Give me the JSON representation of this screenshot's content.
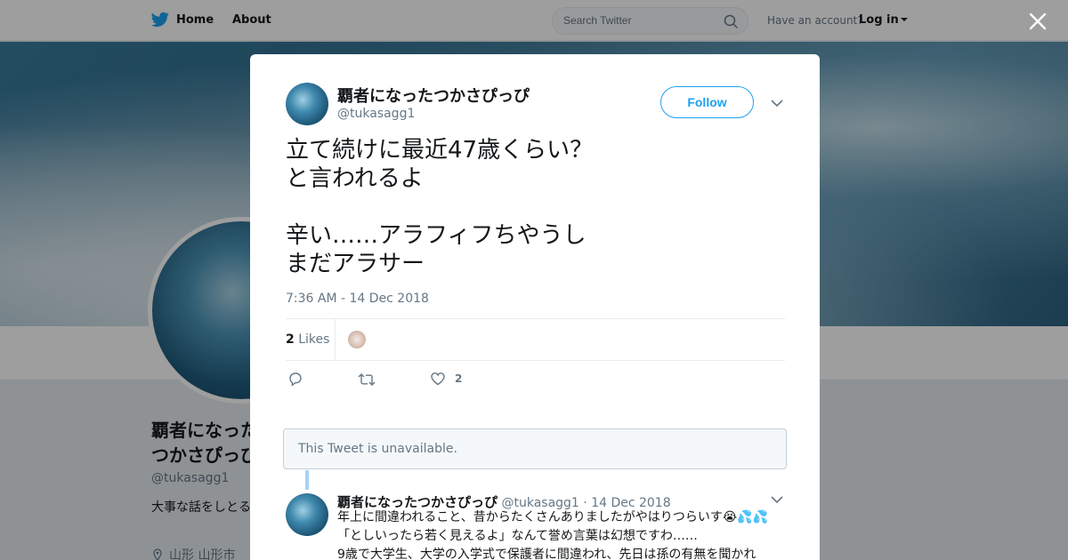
{
  "topbar": {
    "home_label": "Home",
    "about_label": "About",
    "search_placeholder": "Search Twitter",
    "account_prompt": "Have an account?",
    "login_label": "Log in"
  },
  "profile": {
    "name": "覇者になったつかさぴっぴ",
    "handle": "@tukasagg1",
    "bio": "大事な話をしとるマンミサンドリス",
    "location": "山形 山形市"
  },
  "tweet": {
    "author_name": "覇者になったつかさぴっぴ",
    "author_handle": "@tukasagg1",
    "follow_label": "Follow",
    "text_lines": [
      "立て続けに最近47歳くらい？",
      "と言われるよ",
      "",
      "辛い……アラフィフちやうし",
      "まだアラサー"
    ],
    "timestamp": "7:36 AM - 14 Dec 2018",
    "likes_count": "2",
    "likes_label": "Likes",
    "like_action_count": "2"
  },
  "unavailable_notice": "This Tweet is unavailable.",
  "reply": {
    "author_name": "覇者になったつかさぴっぴ",
    "author_handle": "@tukasagg1",
    "separator": "·",
    "date": "14 Dec 2018",
    "lines": [
      "年上に間違われること、昔からたくさんありましたがやはりつらいす😭💦💦",
      "「としいったら若く見えるよ」なんて誉め言葉は幻想ですわ……",
      "9歳で大学生、大学の入学式で保護者に間違われ、先日は孫の有無を聞かれ"
    ]
  },
  "colors": {
    "twitter_blue": "#1da1f2",
    "text_primary": "#14171a",
    "text_secondary": "#657786"
  }
}
